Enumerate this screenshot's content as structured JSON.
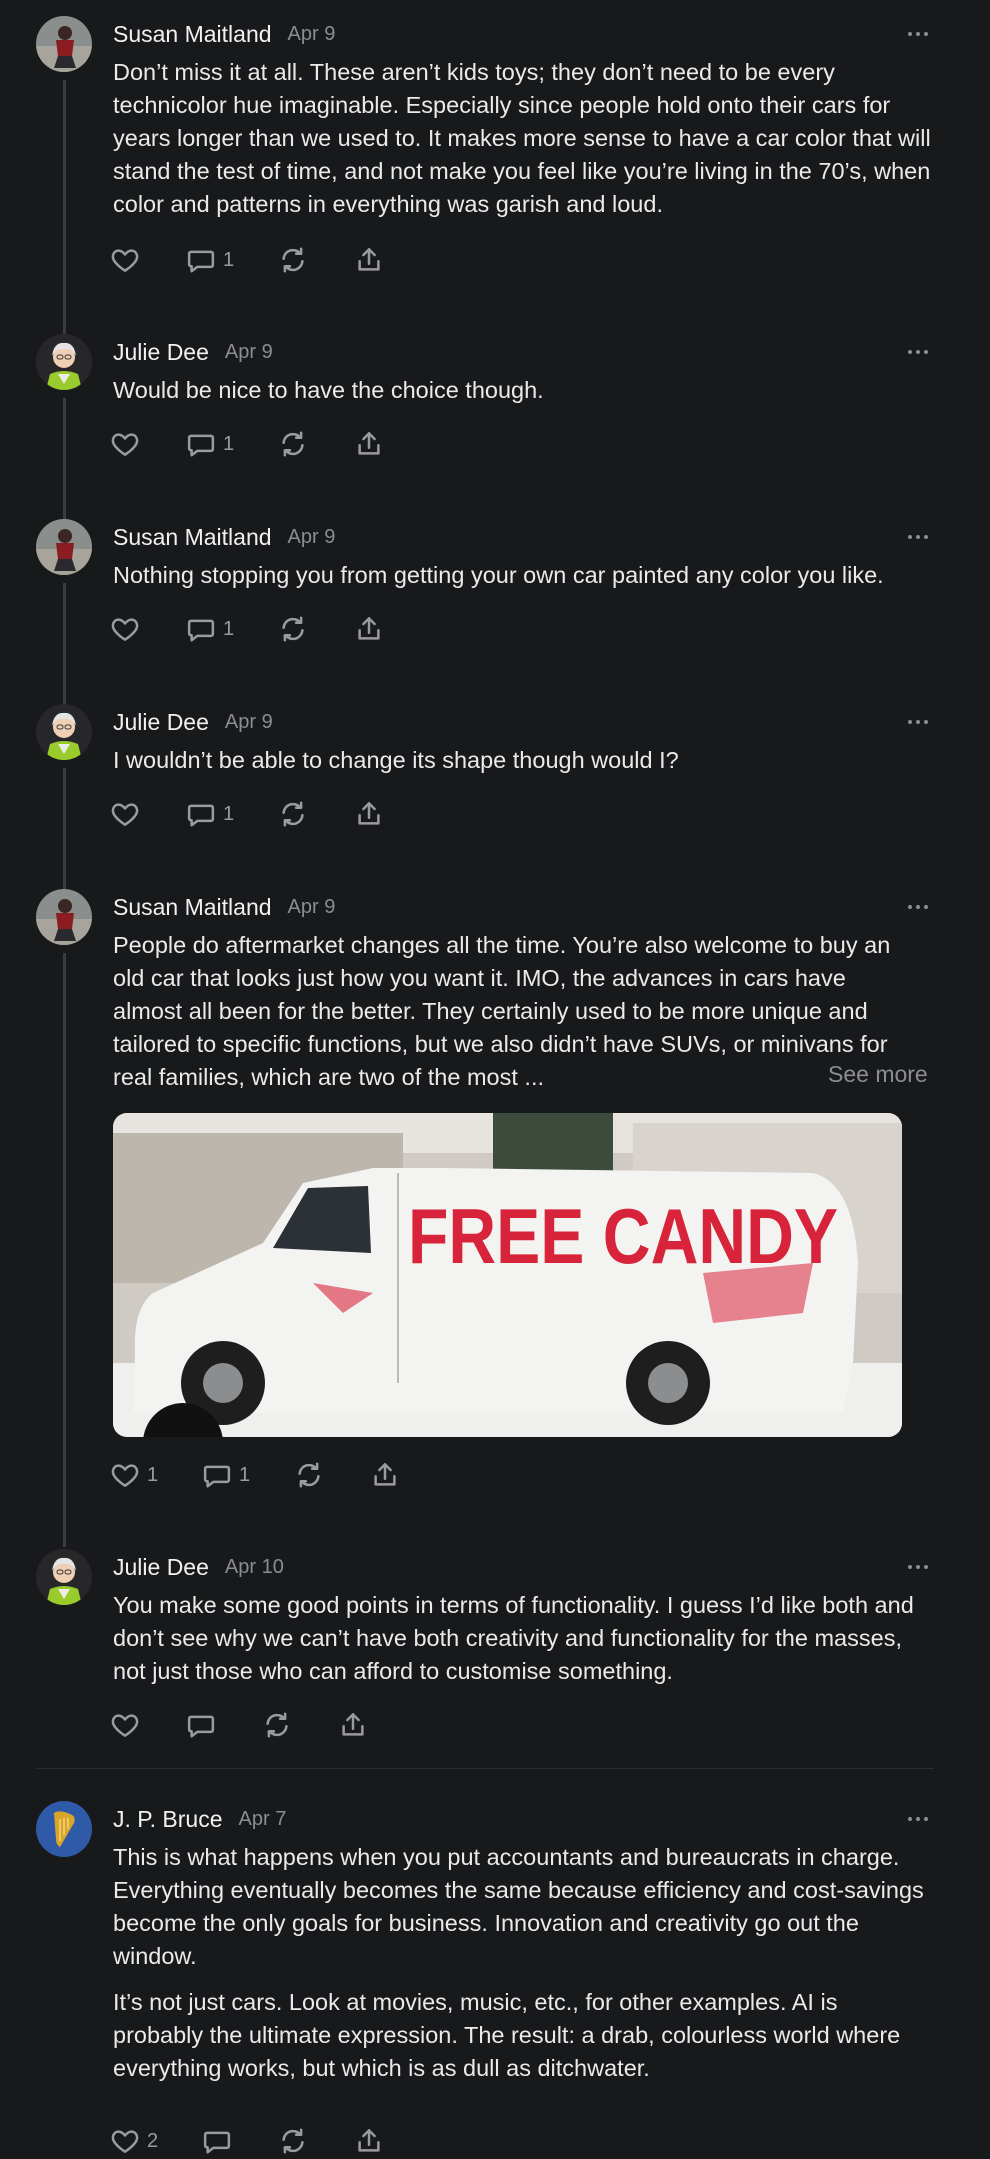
{
  "posts": [
    {
      "author": "Susan Maitland",
      "date": "Apr 9",
      "avatar_icon": "susan-avatar",
      "text": [
        "Don’t miss it at all. These aren’t kids toys; they don’t need to be every technicolor hue imaginable. Especially since people hold onto their cars for years longer than we used to. It makes more sense to have a car color that will stand the test of time, and not make you feel like you’re living in the 70’s, when color and patterns in everything was garish and loud."
      ],
      "likes": "",
      "replies": "1"
    },
    {
      "author": "Julie Dee",
      "date": "Apr 9",
      "avatar_icon": "julie-avatar",
      "text": [
        "Would be nice to have the choice though."
      ],
      "likes": "",
      "replies": "1"
    },
    {
      "author": "Susan Maitland",
      "date": "Apr 9",
      "avatar_icon": "susan-avatar",
      "text": [
        "Nothing stopping you from getting your own car painted any color you like."
      ],
      "likes": "",
      "replies": "1"
    },
    {
      "author": "Julie Dee",
      "date": "Apr 9",
      "avatar_icon": "julie-avatar",
      "text": [
        "I wouldn’t be able to change its shape though would I?"
      ],
      "likes": "",
      "replies": "1"
    },
    {
      "author": "Susan Maitland",
      "date": "Apr 9",
      "avatar_icon": "susan-avatar",
      "text": [
        "People do aftermarket changes all the time. You’re also welcome to buy an old car that looks just how you want it. IMO, the advances in cars have almost all been for the better. They certainly used to be more unique and tailored to specific functions, but we also didn’t have SUVs, or minivans for real families, which are two of the most ..."
      ],
      "see_more": "See more",
      "image_text": "FREE CANDY",
      "likes": "1",
      "replies": "1"
    },
    {
      "author": "Julie Dee",
      "date": "Apr 10",
      "avatar_icon": "julie-avatar",
      "text": [
        "You make some good points in terms of functionality. I guess I’d like both and don’t see why we can’t have both creativity and functionality for the masses, not just those who can afford to customise something."
      ],
      "likes": "",
      "replies": ""
    },
    {
      "author": "J. P. Bruce",
      "date": "Apr 7",
      "avatar_icon": "harp-avatar",
      "text": [
        "This is what happens when you put accountants and bureaucrats in charge. Everything eventually becomes the same because efficiency and cost-savings become the only goals for business. Innovation and creativity go out the window.",
        "It’s not just cars. Look at movies, music, etc., for other examples. AI is probably the ultimate expression. The result: a drab, colourless world where everything works, but which is as dull as ditchwater."
      ],
      "likes": "2",
      "replies": ""
    }
  ],
  "icons": [
    "heart-icon",
    "comment-icon",
    "restack-icon",
    "share-icon",
    "more-icon"
  ],
  "colors": {
    "background": "#18191b",
    "text": "#eceded",
    "muted": "#8c8d91",
    "van_paint": "#d8243a"
  }
}
